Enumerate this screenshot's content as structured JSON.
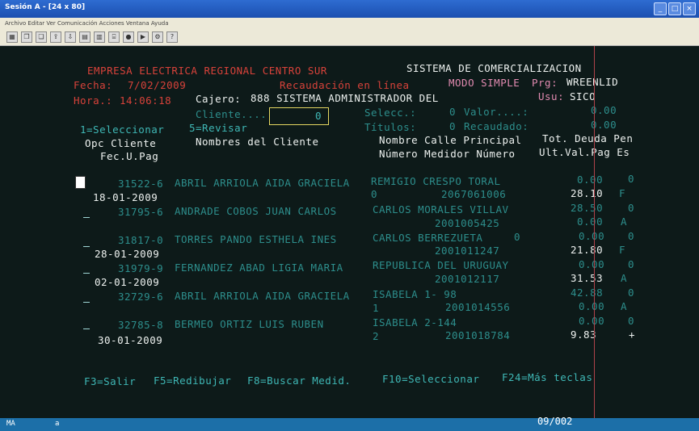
{
  "window": {
    "title": "Sesión A - [24 x 80]"
  },
  "menu": {
    "text": "Archivo  Editar  Ver  Comunicación  Acciones  Ventana  Ayuda"
  },
  "header": {
    "company": "EMPRESA ELECTRICA REGIONAL CENTRO SUR",
    "system": "SISTEMA DE COMERCIALIZACION",
    "fecha_label": "Fecha:",
    "fecha": "7/02/2009",
    "recaudacion": "Recaudación en línea",
    "modo": "MODO SIMPLE",
    "prg_label": "Prg:",
    "prg": "WREENLID",
    "hora_label": "Hora.:",
    "hora": "14:06:18",
    "cajero_label": "Cajero:",
    "cajero": "888 SISTEMA ADMINISTRADOR DEL",
    "usu_label": "Usu:",
    "usu": "SICO",
    "cliente_label": "Cliente....",
    "cliente_value": "0",
    "selecc_label": "Selecc.:",
    "selecc": "0",
    "valor_label": "Valor....:",
    "valor": "0.00",
    "titulos_label": "Títulos:",
    "titulos": "0",
    "recaudado_label": "Recaudado:",
    "recaudado": "0.00",
    "opt1": "1=Seleccionar",
    "opt5": "5=Revisar"
  },
  "columns": {
    "opc": "Opc Cliente",
    "fec": "Fec.U.Pag",
    "nombres": "Nombres del Cliente",
    "calle": "Nombre Calle Principal",
    "numero": "Número Medidor Número",
    "tot": "Tot. Deuda Pen",
    "ult": "Ult.Val.Pag Es"
  },
  "rows": [
    {
      "cliente": "31522-6",
      "nombre": "ABRIL ARRIOLA AIDA GRACIELA",
      "calle": "REMIGIO CRESPO TORAL",
      "num": "0",
      "medidor": "2067061006",
      "deuda": "0.00",
      "es1": "0",
      "fecha": "18-01-2009",
      "ultval": "28.10",
      "es2": "F"
    },
    {
      "cliente": "31795-6",
      "nombre": "ANDRADE COBOS JUAN CARLOS",
      "calle": "CARLOS MORALES VILLAV",
      "num": "",
      "medidor": "2001005425",
      "deuda": "28.50",
      "es1": "0",
      "fecha": "",
      "ultval": "0.00",
      "es2": "A"
    },
    {
      "cliente": "31817-0",
      "nombre": "TORRES PANDO ESTHELA INES",
      "calle": "CARLOS BERREZUETA",
      "num": "0",
      "medidor": "2001011247",
      "deuda": "0.00",
      "es1": "0",
      "fecha": "28-01-2009",
      "ultval": "21.80",
      "es2": "F"
    },
    {
      "cliente": "31979-9",
      "nombre": "FERNANDEZ ABAD LIGIA MARIA",
      "calle": "REPUBLICA DEL URUGUAY",
      "num": "",
      "medidor": "2001012117",
      "deuda": "0.00",
      "es1": "0",
      "fecha": "02-01-2009",
      "ultval": "31.53",
      "es2": "A"
    },
    {
      "cliente": "32729-6",
      "nombre": "ABRIL ARRIOLA AIDA GRACIELA",
      "calle": "ISABELA 1- 98",
      "num": "1",
      "medidor": "2001014556",
      "deuda": "42.88",
      "es1": "0",
      "fecha": "",
      "ultval": "0.00",
      "es2": "A"
    },
    {
      "cliente": "32785-8",
      "nombre": "BERMEO ORTIZ LUIS RUBEN",
      "calle": "ISABELA 2-144",
      "num": "2",
      "medidor": "2001018784",
      "deuda": "0.00",
      "es1": "0",
      "fecha": "30-01-2009",
      "ultval": "9.83",
      "es2": "+"
    }
  ],
  "fkeys": {
    "f3": "F3=Salir",
    "f5": "F5=Redibujar",
    "f8": "F8=Buscar Medid.",
    "f10": "F10=Seleccionar",
    "f24": "F24=Más teclas"
  },
  "status": {
    "mode": "MA",
    "indicator": "a",
    "page": "09/002"
  }
}
